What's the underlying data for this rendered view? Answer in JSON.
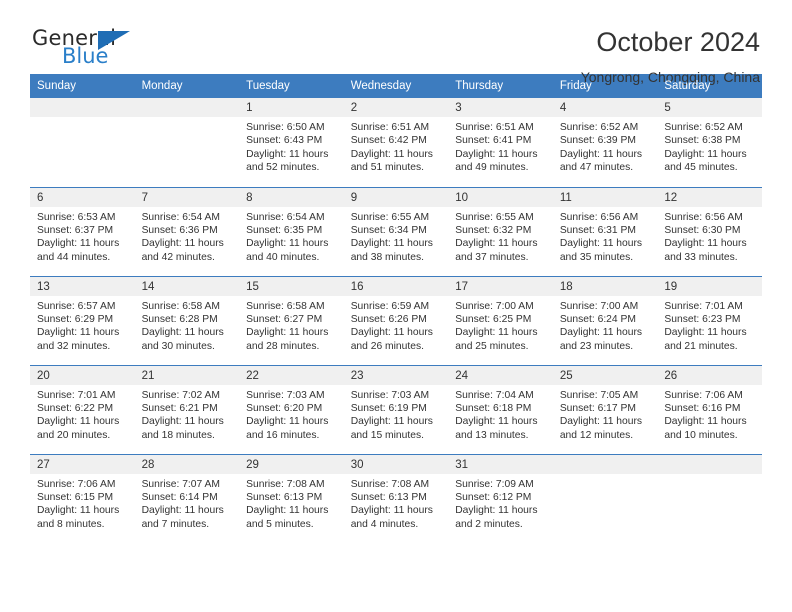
{
  "brand": {
    "name_top": "General",
    "name_bottom": "Blue",
    "triangle_color": "#1f6db5",
    "blue_text_color": "#2a7fc9"
  },
  "header": {
    "title": "October 2024",
    "subtitle": "Yongrong, Chongqing, China"
  },
  "theme": {
    "header_blue": "#3d7cbf",
    "daynum_band": "#f0f0f0",
    "text": "#333333"
  },
  "labels": {
    "sunrise_prefix": "Sunrise: ",
    "sunset_prefix": "Sunset: ",
    "daylight_prefix": "Daylight: "
  },
  "weekday_headers": [
    "Sunday",
    "Monday",
    "Tuesday",
    "Wednesday",
    "Thursday",
    "Friday",
    "Saturday"
  ],
  "weeks": [
    [
      {
        "empty": true
      },
      {
        "empty": true
      },
      {
        "day": "1",
        "sunrise": "Sunrise: 6:50 AM",
        "sunset": "Sunset: 6:43 PM",
        "daylight_line1": "Daylight: 11 hours",
        "daylight_line2": "and 52 minutes."
      },
      {
        "day": "2",
        "sunrise": "Sunrise: 6:51 AM",
        "sunset": "Sunset: 6:42 PM",
        "daylight_line1": "Daylight: 11 hours",
        "daylight_line2": "and 51 minutes."
      },
      {
        "day": "3",
        "sunrise": "Sunrise: 6:51 AM",
        "sunset": "Sunset: 6:41 PM",
        "daylight_line1": "Daylight: 11 hours",
        "daylight_line2": "and 49 minutes."
      },
      {
        "day": "4",
        "sunrise": "Sunrise: 6:52 AM",
        "sunset": "Sunset: 6:39 PM",
        "daylight_line1": "Daylight: 11 hours",
        "daylight_line2": "and 47 minutes."
      },
      {
        "day": "5",
        "sunrise": "Sunrise: 6:52 AM",
        "sunset": "Sunset: 6:38 PM",
        "daylight_line1": "Daylight: 11 hours",
        "daylight_line2": "and 45 minutes."
      }
    ],
    [
      {
        "day": "6",
        "sunrise": "Sunrise: 6:53 AM",
        "sunset": "Sunset: 6:37 PM",
        "daylight_line1": "Daylight: 11 hours",
        "daylight_line2": "and 44 minutes."
      },
      {
        "day": "7",
        "sunrise": "Sunrise: 6:54 AM",
        "sunset": "Sunset: 6:36 PM",
        "daylight_line1": "Daylight: 11 hours",
        "daylight_line2": "and 42 minutes."
      },
      {
        "day": "8",
        "sunrise": "Sunrise: 6:54 AM",
        "sunset": "Sunset: 6:35 PM",
        "daylight_line1": "Daylight: 11 hours",
        "daylight_line2": "and 40 minutes."
      },
      {
        "day": "9",
        "sunrise": "Sunrise: 6:55 AM",
        "sunset": "Sunset: 6:34 PM",
        "daylight_line1": "Daylight: 11 hours",
        "daylight_line2": "and 38 minutes."
      },
      {
        "day": "10",
        "sunrise": "Sunrise: 6:55 AM",
        "sunset": "Sunset: 6:32 PM",
        "daylight_line1": "Daylight: 11 hours",
        "daylight_line2": "and 37 minutes."
      },
      {
        "day": "11",
        "sunrise": "Sunrise: 6:56 AM",
        "sunset": "Sunset: 6:31 PM",
        "daylight_line1": "Daylight: 11 hours",
        "daylight_line2": "and 35 minutes."
      },
      {
        "day": "12",
        "sunrise": "Sunrise: 6:56 AM",
        "sunset": "Sunset: 6:30 PM",
        "daylight_line1": "Daylight: 11 hours",
        "daylight_line2": "and 33 minutes."
      }
    ],
    [
      {
        "day": "13",
        "sunrise": "Sunrise: 6:57 AM",
        "sunset": "Sunset: 6:29 PM",
        "daylight_line1": "Daylight: 11 hours",
        "daylight_line2": "and 32 minutes."
      },
      {
        "day": "14",
        "sunrise": "Sunrise: 6:58 AM",
        "sunset": "Sunset: 6:28 PM",
        "daylight_line1": "Daylight: 11 hours",
        "daylight_line2": "and 30 minutes."
      },
      {
        "day": "15",
        "sunrise": "Sunrise: 6:58 AM",
        "sunset": "Sunset: 6:27 PM",
        "daylight_line1": "Daylight: 11 hours",
        "daylight_line2": "and 28 minutes."
      },
      {
        "day": "16",
        "sunrise": "Sunrise: 6:59 AM",
        "sunset": "Sunset: 6:26 PM",
        "daylight_line1": "Daylight: 11 hours",
        "daylight_line2": "and 26 minutes."
      },
      {
        "day": "17",
        "sunrise": "Sunrise: 7:00 AM",
        "sunset": "Sunset: 6:25 PM",
        "daylight_line1": "Daylight: 11 hours",
        "daylight_line2": "and 25 minutes."
      },
      {
        "day": "18",
        "sunrise": "Sunrise: 7:00 AM",
        "sunset": "Sunset: 6:24 PM",
        "daylight_line1": "Daylight: 11 hours",
        "daylight_line2": "and 23 minutes."
      },
      {
        "day": "19",
        "sunrise": "Sunrise: 7:01 AM",
        "sunset": "Sunset: 6:23 PM",
        "daylight_line1": "Daylight: 11 hours",
        "daylight_line2": "and 21 minutes."
      }
    ],
    [
      {
        "day": "20",
        "sunrise": "Sunrise: 7:01 AM",
        "sunset": "Sunset: 6:22 PM",
        "daylight_line1": "Daylight: 11 hours",
        "daylight_line2": "and 20 minutes."
      },
      {
        "day": "21",
        "sunrise": "Sunrise: 7:02 AM",
        "sunset": "Sunset: 6:21 PM",
        "daylight_line1": "Daylight: 11 hours",
        "daylight_line2": "and 18 minutes."
      },
      {
        "day": "22",
        "sunrise": "Sunrise: 7:03 AM",
        "sunset": "Sunset: 6:20 PM",
        "daylight_line1": "Daylight: 11 hours",
        "daylight_line2": "and 16 minutes."
      },
      {
        "day": "23",
        "sunrise": "Sunrise: 7:03 AM",
        "sunset": "Sunset: 6:19 PM",
        "daylight_line1": "Daylight: 11 hours",
        "daylight_line2": "and 15 minutes."
      },
      {
        "day": "24",
        "sunrise": "Sunrise: 7:04 AM",
        "sunset": "Sunset: 6:18 PM",
        "daylight_line1": "Daylight: 11 hours",
        "daylight_line2": "and 13 minutes."
      },
      {
        "day": "25",
        "sunrise": "Sunrise: 7:05 AM",
        "sunset": "Sunset: 6:17 PM",
        "daylight_line1": "Daylight: 11 hours",
        "daylight_line2": "and 12 minutes."
      },
      {
        "day": "26",
        "sunrise": "Sunrise: 7:06 AM",
        "sunset": "Sunset: 6:16 PM",
        "daylight_line1": "Daylight: 11 hours",
        "daylight_line2": "and 10 minutes."
      }
    ],
    [
      {
        "day": "27",
        "sunrise": "Sunrise: 7:06 AM",
        "sunset": "Sunset: 6:15 PM",
        "daylight_line1": "Daylight: 11 hours",
        "daylight_line2": "and 8 minutes."
      },
      {
        "day": "28",
        "sunrise": "Sunrise: 7:07 AM",
        "sunset": "Sunset: 6:14 PM",
        "daylight_line1": "Daylight: 11 hours",
        "daylight_line2": "and 7 minutes."
      },
      {
        "day": "29",
        "sunrise": "Sunrise: 7:08 AM",
        "sunset": "Sunset: 6:13 PM",
        "daylight_line1": "Daylight: 11 hours",
        "daylight_line2": "and 5 minutes."
      },
      {
        "day": "30",
        "sunrise": "Sunrise: 7:08 AM",
        "sunset": "Sunset: 6:13 PM",
        "daylight_line1": "Daylight: 11 hours",
        "daylight_line2": "and 4 minutes."
      },
      {
        "day": "31",
        "sunrise": "Sunrise: 7:09 AM",
        "sunset": "Sunset: 6:12 PM",
        "daylight_line1": "Daylight: 11 hours",
        "daylight_line2": "and 2 minutes."
      },
      {
        "empty": true
      },
      {
        "empty": true
      }
    ]
  ]
}
